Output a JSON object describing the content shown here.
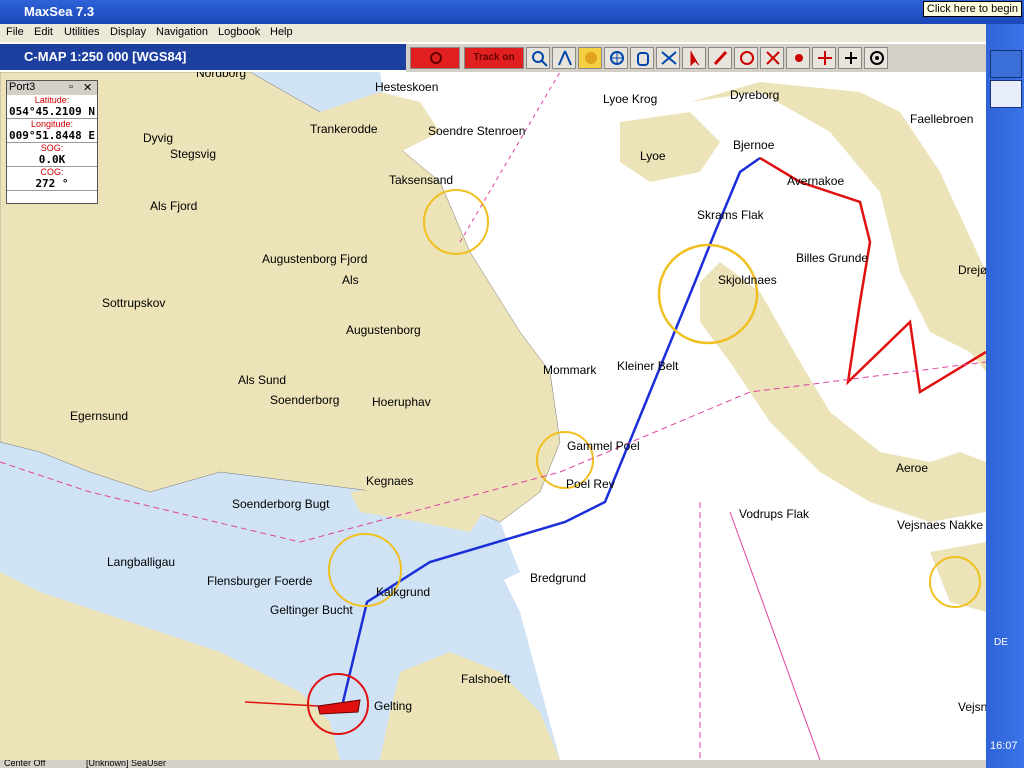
{
  "window": {
    "title": "MaxSea 7.3",
    "tooltip": "Click here to begin"
  },
  "menu": [
    "File",
    "Edit",
    "Utilities",
    "Display",
    "Navigation",
    "Logbook",
    "Help"
  ],
  "chart": {
    "title": "C-MAP  1:250 000 [WGS84]",
    "track_label": "Track on"
  },
  "panel": {
    "title": "Port3",
    "latitude_label": "Latitude:",
    "latitude": "054°45.2109 N",
    "longitude_label": "Longitude:",
    "longitude": "009°51.8448 E",
    "sog_label": "SOG:",
    "sog": "0.0K",
    "cog_label": "COG:",
    "cog": "272 °"
  },
  "places": [
    "Hesteskoen",
    "Nordborg",
    "Trankerodde",
    "Soendre Stenroen",
    "Lyoe Krog",
    "Dyreborg",
    "Faellebroen",
    "Lyoe",
    "Bjernoe",
    "Avernakoe",
    "Dyvig",
    "Stegsvig",
    "Als Fjord",
    "Taksensand",
    "Skrams Flak",
    "Billes Grunde",
    "Augustenborg Fjord",
    "Als",
    "Skjoldnaes",
    "Sottrupskov",
    "Augustenborg",
    "Mommark",
    "Kleiner Belt",
    "Als Sund",
    "Soenderborg",
    "Hoeruphav",
    "Egernsund",
    "Gammel Poel",
    "Aeroe",
    "Kegnaes",
    "Poel Rev",
    "Soenderborg Bugt",
    "Vodrups Flak",
    "Vejsnaes Nakke",
    "Langballigau",
    "Flensburger Foerde",
    "Bredgrund",
    "Kalkgrund",
    "Geltinger Bucht",
    "Falshoeft",
    "Gelting",
    "Vejsnaes",
    "Drejø"
  ],
  "status": {
    "left": "Center Off",
    "user": "[Unknown] SeaUser"
  },
  "taskbar": {
    "lang": "DE",
    "clock": "16:07"
  }
}
